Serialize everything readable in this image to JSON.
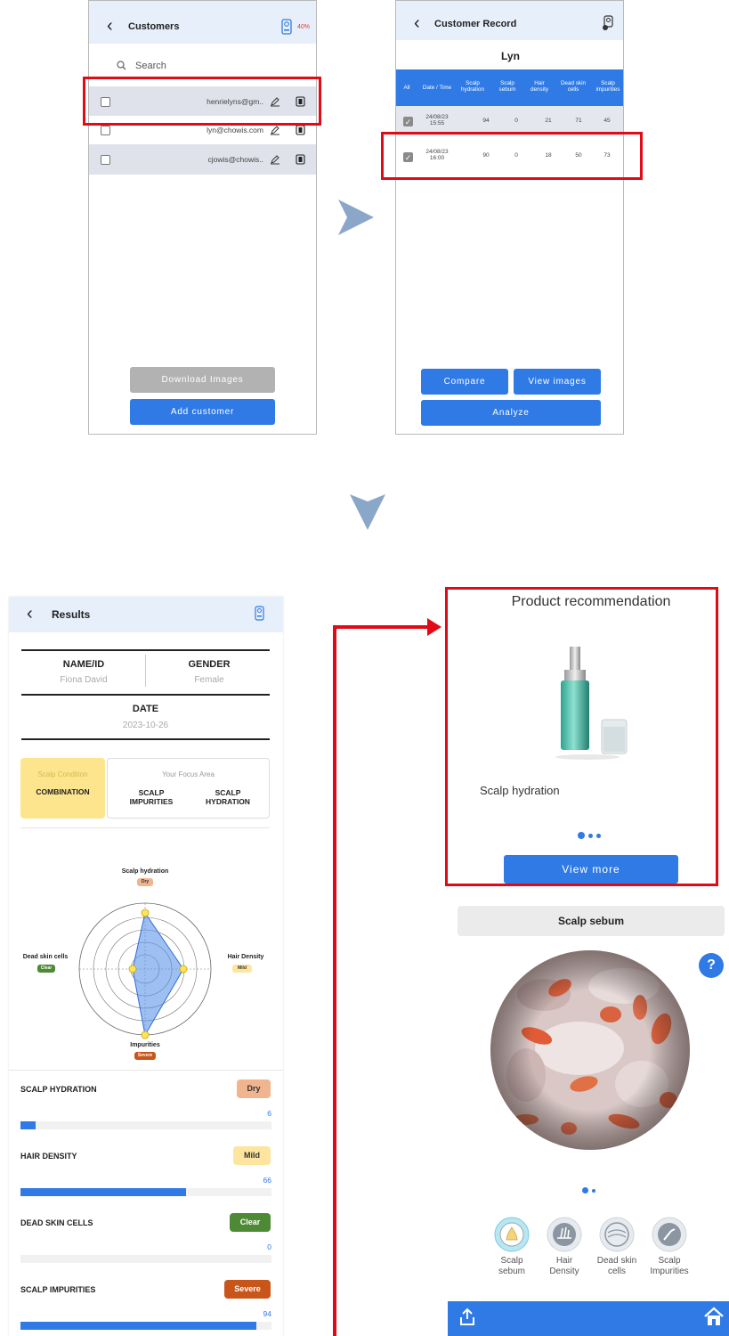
{
  "customers": {
    "title": "Customers",
    "battery": "40%",
    "search_placeholder": "Search",
    "rows": [
      "henrielyns@gm..",
      "lyn@chowis.com",
      "cjowis@chowis.."
    ],
    "download_label": "Download Images",
    "add_label": "Add customer"
  },
  "record": {
    "title": "Customer Record",
    "customer_name": "Lyn",
    "headers": {
      "all": "All",
      "date": "Date / Time",
      "c1": "Scalp hydration",
      "c2": "Scalp sebum",
      "c3": "Hair density",
      "c4": "Dead skin cells",
      "c5": "Scalp impurities"
    },
    "rows": [
      {
        "date": "24/08/23",
        "time": "15:55",
        "v1": "94",
        "v2": "0",
        "v3": "21",
        "v4": "71",
        "v5": "45"
      },
      {
        "date": "24/08/23",
        "time": "16:00",
        "v1": "90",
        "v2": "0",
        "v3": "18",
        "v4": "50",
        "v5": "73"
      }
    ],
    "compare_label": "Compare",
    "view_images_label": "View images",
    "analyze_label": "Analyze"
  },
  "results": {
    "title": "Results",
    "name_label": "NAME/ID",
    "name_value": "Fiona David",
    "gender_label": "GENDER",
    "gender_value": "Female",
    "date_label": "DATE",
    "date_value": "2023-10-26",
    "condition_label": "Scalp Condition",
    "condition_value": "COMBINATION",
    "focus_label": "Your Focus Area",
    "focus_1a": "SCALP",
    "focus_1b": "IMPURITIES",
    "focus_2a": "SCALP",
    "focus_2b": "HYDRATION",
    "radar": {
      "top_label": "Scalp hydration",
      "top_badge": "Dry",
      "right_label": "Hair Density",
      "right_badge": "Mild",
      "bottom_label": "Impurities",
      "bottom_badge": "Severe",
      "left_label": "Dead skin cells",
      "left_badge": "Clear"
    },
    "metrics": [
      {
        "label": "SCALP HYDRATION",
        "badge": "Dry",
        "value": "6",
        "pct": 6
      },
      {
        "label": "HAIR DENSITY",
        "badge": "Mild",
        "value": "66",
        "pct": 66
      },
      {
        "label": "DEAD SKIN CELLS",
        "badge": "Clear",
        "value": "0",
        "pct": 0
      },
      {
        "label": "SCALP IMPURITIES",
        "badge": "Severe",
        "value": "94",
        "pct": 94
      }
    ],
    "colors": {
      "dry": "#f0b58f",
      "mild": "#fde5a0",
      "clear": "#4e8a36",
      "severe": "#c8561b"
    }
  },
  "product": {
    "title": "Product recommendation",
    "name": "Scalp hydration",
    "view_more_label": "View more"
  },
  "sebum": {
    "title": "Scalp sebum",
    "help": "?",
    "tabs": [
      {
        "l1": "Scalp",
        "l2": "sebum"
      },
      {
        "l1": "Hair",
        "l2": "Density"
      },
      {
        "l1": "Dead skin",
        "l2": "cells"
      },
      {
        "l1": "Scalp",
        "l2": "Impurities"
      }
    ]
  }
}
